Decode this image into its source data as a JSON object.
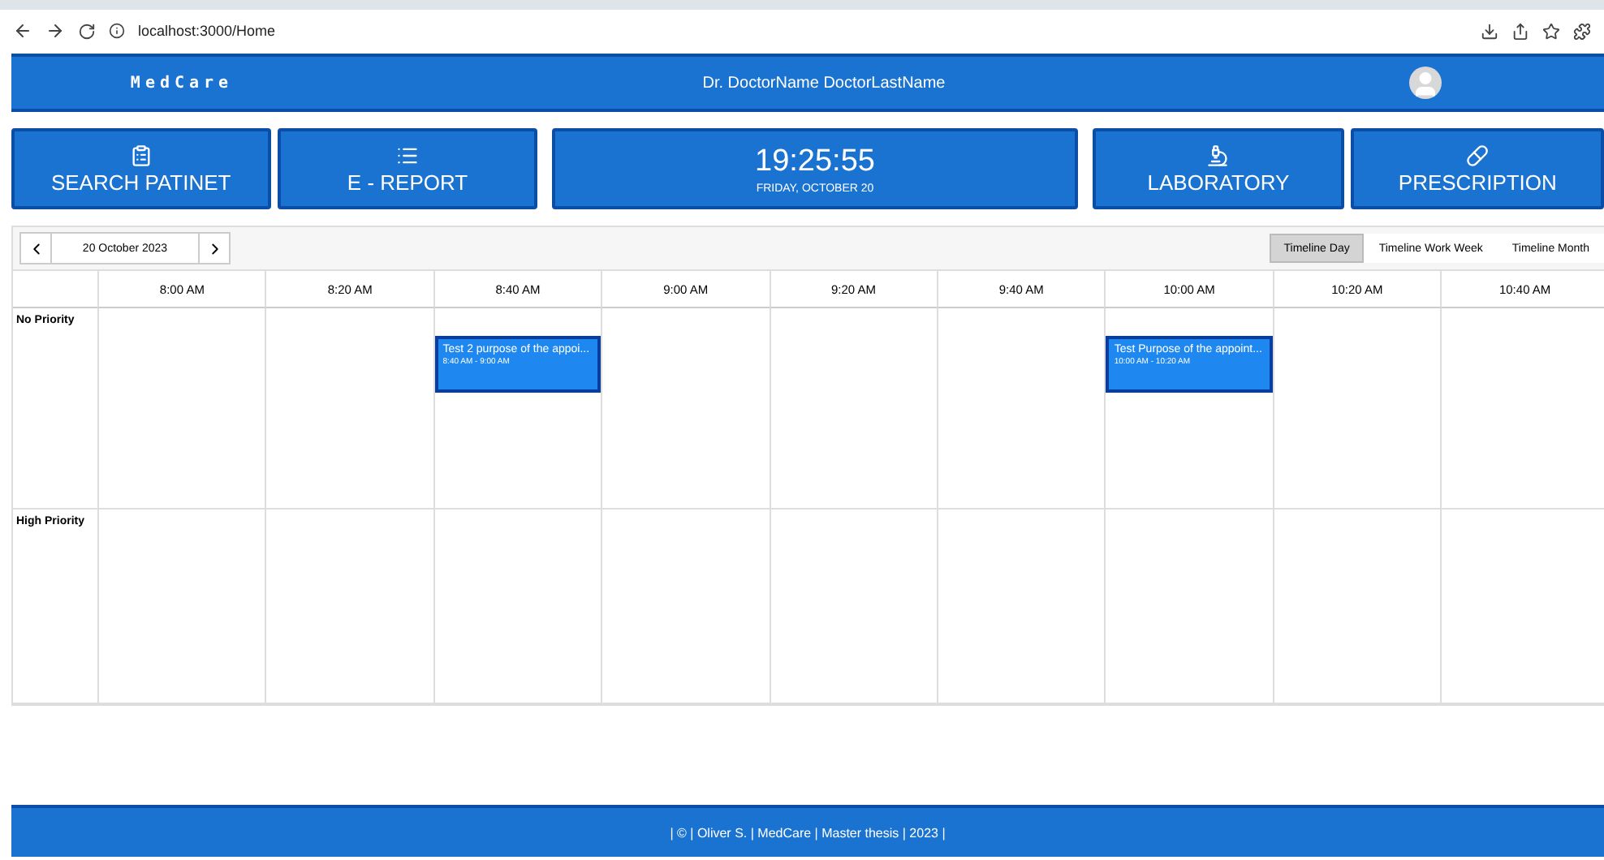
{
  "browser": {
    "url": "localhost:3000/Home"
  },
  "header": {
    "brand": "MedCare",
    "doctor": "Dr. DoctorName DoctorLastName"
  },
  "tiles": [
    {
      "kind": "search",
      "label": "SEARCH PATINET"
    },
    {
      "kind": "report",
      "label": "E - REPORT"
    },
    {
      "kind": "clock",
      "time": "19:25:55",
      "date": "FRIDAY, OCTOBER 20"
    },
    {
      "kind": "lab",
      "label": "LABORATORY"
    },
    {
      "kind": "prescription",
      "label": "PRESCRIPTION"
    }
  ],
  "scheduler": {
    "date": "20 October 2023",
    "views": [
      {
        "label": "Timeline Day",
        "selected": true
      },
      {
        "label": "Timeline Work Week",
        "selected": false
      },
      {
        "label": "Timeline Month",
        "selected": false
      }
    ],
    "columns": [
      "8:00 AM",
      "8:20 AM",
      "8:40 AM",
      "9:00 AM",
      "9:20 AM",
      "9:40 AM",
      "10:00 AM",
      "10:20 AM",
      "10:40 AM"
    ],
    "rows": [
      {
        "label": "No Priority",
        "slots": [
          {
            "kind": "empty"
          },
          {
            "kind": "empty"
          },
          {
            "kind": "event",
            "title": "Test 2 purpose of the appoi...",
            "time": "8:40 AM - 9:00 AM"
          },
          {
            "kind": "empty"
          },
          {
            "kind": "empty"
          },
          {
            "kind": "empty"
          },
          {
            "kind": "event",
            "title": "Test Purpose of the appoint...",
            "time": "10:00 AM - 10:20 AM"
          },
          {
            "kind": "empty"
          },
          {
            "kind": "empty"
          }
        ]
      },
      {
        "label": "High Priority",
        "slots": [
          {
            "kind": "empty"
          },
          {
            "kind": "empty"
          },
          {
            "kind": "empty"
          },
          {
            "kind": "empty"
          },
          {
            "kind": "empty"
          },
          {
            "kind": "empty"
          },
          {
            "kind": "empty"
          },
          {
            "kind": "empty"
          },
          {
            "kind": "empty"
          }
        ]
      }
    ]
  },
  "footer": "| © | Oliver S. | MedCare | Master thesis | 2023 |"
}
